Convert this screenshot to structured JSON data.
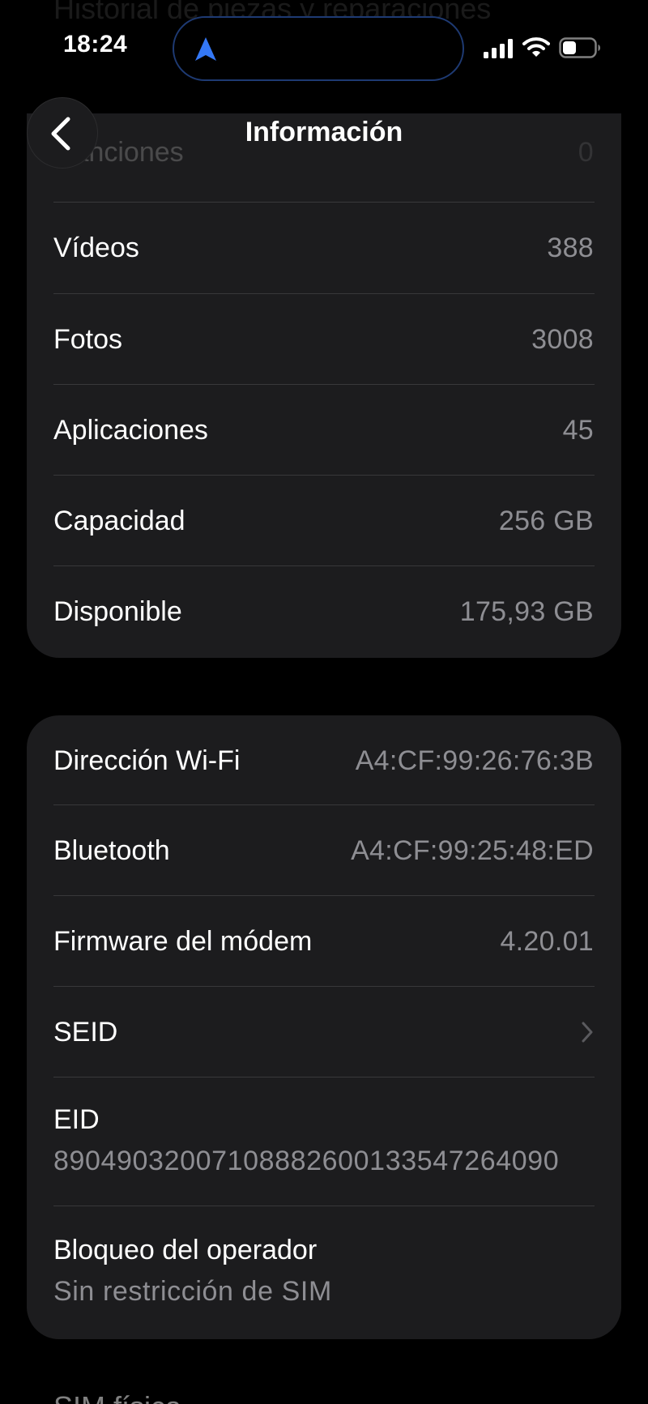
{
  "status_bar": {
    "time": "18:24"
  },
  "background_top_text": "Historial de piezas y reparaciones",
  "nav": {
    "title": "Información"
  },
  "group1": {
    "ghost_row": {
      "label": "Canciones",
      "value": "0"
    },
    "rows": [
      {
        "label": "Vídeos",
        "value": "388"
      },
      {
        "label": "Fotos",
        "value": "3008"
      },
      {
        "label": "Aplicaciones",
        "value": "45"
      },
      {
        "label": "Capacidad",
        "value": "256 GB"
      },
      {
        "label": "Disponible",
        "value": "175,93 GB"
      }
    ]
  },
  "group2": {
    "wifi": {
      "label": "Dirección Wi-Fi",
      "value": "A4:CF:99:26:76:3B"
    },
    "bluetooth": {
      "label": "Bluetooth",
      "value": "A4:CF:99:25:48:ED"
    },
    "modem": {
      "label": "Firmware del módem",
      "value": "4.20.01"
    },
    "seid": {
      "label": "SEID"
    },
    "eid": {
      "label": "EID",
      "value": "89049032007108882600133547264090"
    },
    "carrier_lock": {
      "label": "Bloqueo del operador",
      "value": "Sin restricción de SIM"
    }
  },
  "bottom_ghost_text": "SIM física",
  "colors": {
    "background": "#000000",
    "card": "#1c1c1e",
    "secondary_text": "#8e8e93",
    "divider": "#38383a",
    "island_border": "#1e3a73",
    "nav_arrow": "#3478f6"
  }
}
